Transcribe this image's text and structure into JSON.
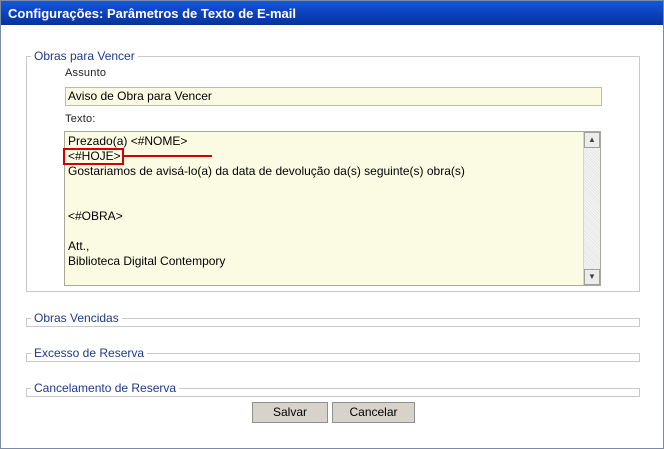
{
  "window": {
    "title": "Configurações: Parâmetros de Texto de E-mail"
  },
  "sections": {
    "obras_para_vencer": {
      "legend": "Obras para Vencer",
      "assunto_label": "Assunto",
      "assunto_value": "Aviso de Obra para Vencer",
      "texto_label": "Texto:",
      "texto_lines": [
        "Prezado(a) <#NOME>",
        "<#HOJE>",
        "Gostariamos de avisá-lo(a) da data de devolução da(s) seguinte(s) obra(s)",
        "",
        "",
        "<#OBRA>",
        "",
        "Att.,",
        "Biblioteca Digital Contempory"
      ]
    },
    "obras_vencidas": {
      "legend": "Obras Vencidas"
    },
    "excesso_de_reserva": {
      "legend": "Excesso de Reserva"
    },
    "cancelamento_de_reserva": {
      "legend": "Cancelamento de Reserva"
    }
  },
  "buttons": {
    "salvar": "Salvar",
    "cancelar": "Cancelar"
  },
  "icons": {
    "scroll_up": "scroll-up-arrow-icon",
    "scroll_down": "scroll-down-arrow-icon"
  },
  "colors": {
    "titlebar": "#0b3fb8",
    "legend_text": "#1a3a8c",
    "input_bg": "#fbfbe4",
    "highlight": "#d40000"
  }
}
